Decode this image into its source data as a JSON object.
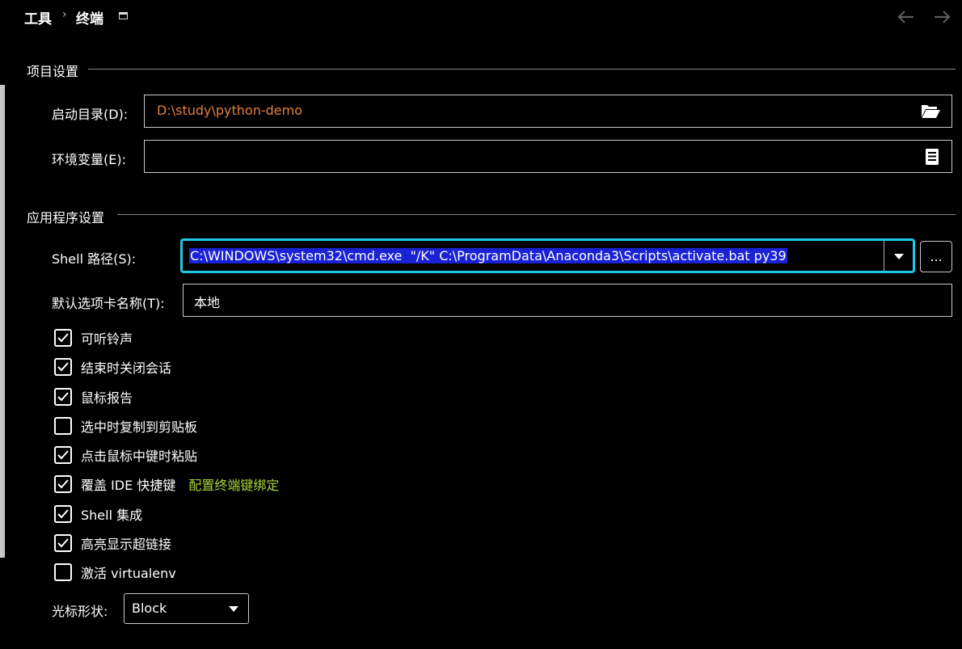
{
  "header": {
    "crumb_tools": "工具",
    "crumb_separator": "›",
    "crumb_terminal": "终端",
    "back_icon": "back-arrow-icon",
    "forward_icon": "forward-arrow-icon",
    "window_icon": "window-icon"
  },
  "project_settings": {
    "title": "项目设置",
    "start_dir_label": "启动目录(D):",
    "start_dir_value": "D:\\study\\python-demo",
    "start_dir_value_color": "#e0813f",
    "env_label": "环境变量(E):",
    "env_value": ""
  },
  "app_settings": {
    "title": "应用程序设置",
    "shell_label": "Shell 路径(S):",
    "shell_value": "C:\\WINDOWS\\system32\\cmd.exe  \"/K\" C:\\ProgramData\\Anaconda3\\Scripts\\activate.bat py39",
    "shell_browse_label": "...",
    "tab_name_label": "默认选项卡名称(T):",
    "tab_name_value": "本地",
    "focus_color": "#1ec8e8",
    "selection_color": "#1a22d4"
  },
  "checkboxes": [
    {
      "label": "可听铃声",
      "checked": true
    },
    {
      "label": "结束时关闭会话",
      "checked": true
    },
    {
      "label": "鼠标报告",
      "checked": true
    },
    {
      "label": "选中时复制到剪贴板",
      "checked": false
    },
    {
      "label": "点击鼠标中键时粘贴",
      "checked": true
    },
    {
      "label": "覆盖 IDE 快捷键",
      "checked": true,
      "link": "配置终端键绑定"
    },
    {
      "label": "Shell 集成",
      "checked": true
    },
    {
      "label": "高亮显示超链接",
      "checked": true
    },
    {
      "label": "激活 virtualenv",
      "checked": false
    }
  ],
  "cursor": {
    "label": "光标形状:",
    "value": "Block"
  },
  "link_color": "#a8d63c"
}
